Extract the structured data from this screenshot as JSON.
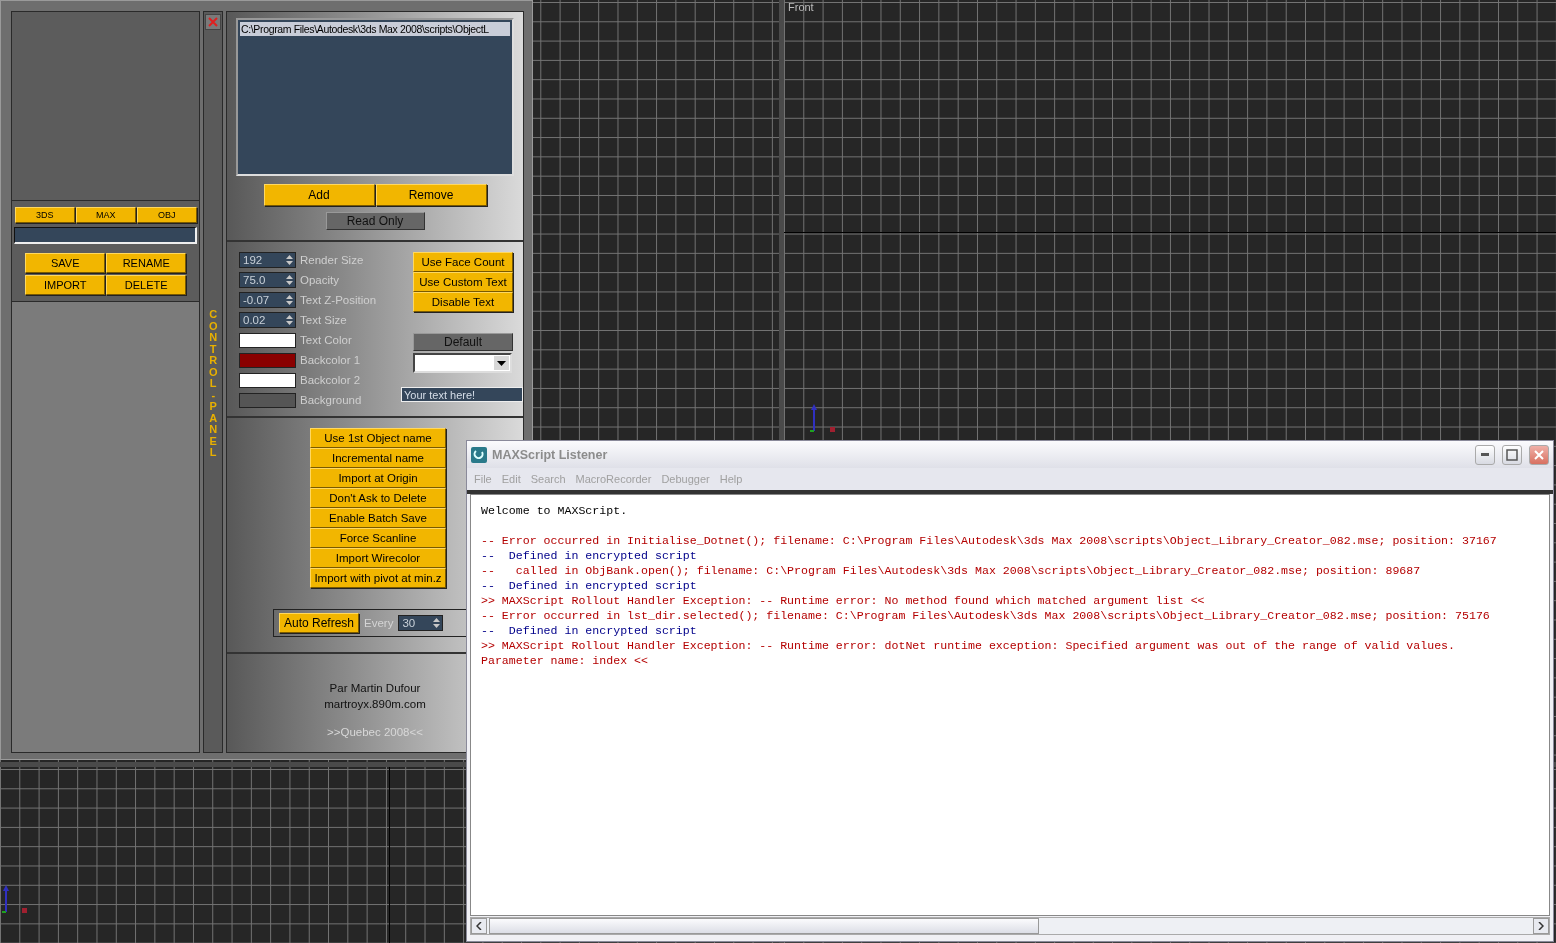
{
  "viewport_label": "Front",
  "panel": {
    "side_title": "CONTROL-PANEL",
    "format_buttons": [
      "3DS",
      "MAX",
      "OBJ"
    ],
    "file_actions": [
      "SAVE",
      "RENAME",
      "IMPORT",
      "DELETE"
    ],
    "folders": [
      {
        "label": "C:\\Program Files\\Autodesk\\3ds Max 2008\\scripts\\ObjectL",
        "selected": true
      }
    ],
    "folder_buttons": [
      "Add",
      "Remove"
    ],
    "read_only": "Read Only",
    "spinners": [
      {
        "value": "192",
        "label": "Render Size"
      },
      {
        "value": "75.0",
        "label": "Opacity"
      },
      {
        "value": "-0.07",
        "label": "Text Z-Position"
      },
      {
        "value": "0.02",
        "label": "Text Size"
      }
    ],
    "colors": [
      {
        "label": "Text Color",
        "color": "#ffffff"
      },
      {
        "label": "Backcolor 1",
        "color": "#8a0000"
      },
      {
        "label": "Backcolor 2",
        "color": "#ffffff"
      },
      {
        "label": "Background",
        "color": "#555555"
      }
    ],
    "text_buttons": [
      "Use Face Count",
      "Use Custom Text",
      "Disable Text"
    ],
    "default_button": "Default",
    "text_field": {
      "value": "Your text here!"
    },
    "options": [
      "Use 1st Object name",
      "Incremental name",
      "Import at Origin",
      "Don't Ask to Delete",
      "Enable Batch Save",
      "Force Scanline",
      "Import Wirecolor",
      "Import with pivot at min.z"
    ],
    "auto_refresh": {
      "label": "Auto Refresh",
      "every": "Every",
      "value": "30"
    },
    "credits": [
      "Par Martin Dufour",
      "martroyx.890m.com",
      ">>Quebec 2008<<"
    ]
  },
  "listener": {
    "title": "MAXScript Listener",
    "menu": [
      "File",
      "Edit",
      "Search",
      "MacroRecorder",
      "Debugger",
      "Help"
    ],
    "lines": [
      {
        "kind": "welcome",
        "text": "Welcome to MAXScript."
      },
      {
        "kind": "error",
        "text": "-- Error occurred in Initialise_Dotnet(); filename: C:\\Program Files\\Autodesk\\3ds Max 2008\\scripts\\Object_Library_Creator_082.mse; position: 37167"
      },
      {
        "kind": "info",
        "text": "--  Defined in encrypted script"
      },
      {
        "kind": "error",
        "text": "--   called in ObjBank.open(); filename: C:\\Program Files\\Autodesk\\3ds Max 2008\\scripts\\Object_Library_Creator_082.mse; position: 89687"
      },
      {
        "kind": "info",
        "text": "--  Defined in encrypted script"
      },
      {
        "kind": "error",
        "text": ">> MAXScript Rollout Handler Exception: -- Runtime error: No method found which matched argument list <<"
      },
      {
        "kind": "error",
        "text": "-- Error occurred in lst_dir.selected(); filename: C:\\Program Files\\Autodesk\\3ds Max 2008\\scripts\\Object_Library_Creator_082.mse; position: 75176"
      },
      {
        "kind": "info",
        "text": "--  Defined in encrypted script"
      },
      {
        "kind": "error",
        "text": ">> MAXScript Rollout Handler Exception: -- Runtime error: dotNet runtime exception: Specified argument was out of the range of valid values."
      },
      {
        "kind": "error",
        "text": "Parameter name: index <<"
      }
    ]
  }
}
